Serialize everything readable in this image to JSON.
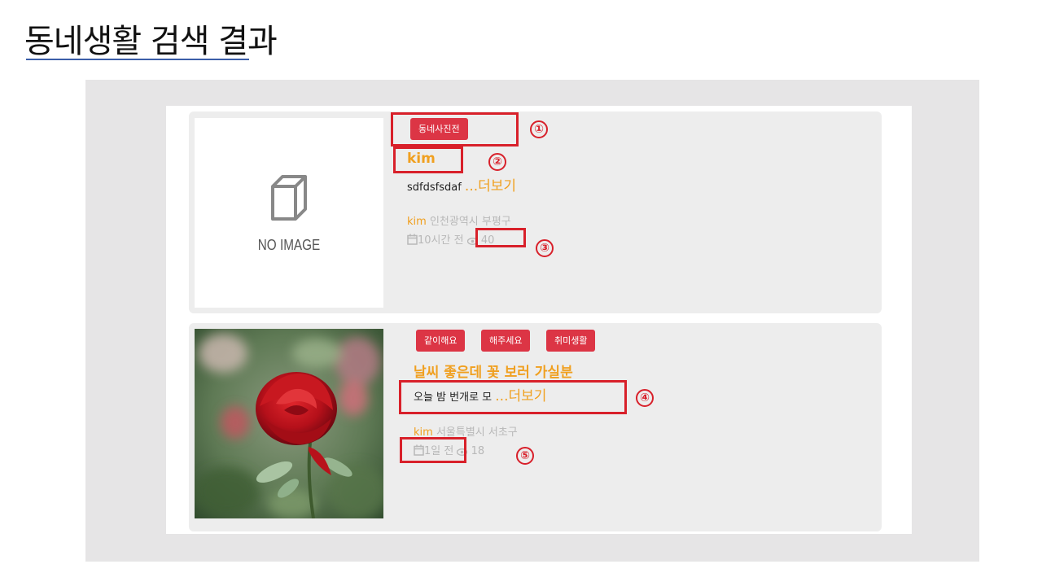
{
  "slide": {
    "title": "동네생활 검색 결과"
  },
  "posts": [
    {
      "tags": [
        "동네사진전"
      ],
      "title": "kim",
      "body": "sdfdsfsdaf",
      "more": "...더보기",
      "author": "kim",
      "location": "인천광역시 부평구",
      "time": "10시간 전",
      "views": "40",
      "thumbnail": {
        "type": "placeholder",
        "text": "NO IMAGE"
      }
    },
    {
      "tags": [
        "같이해요",
        "해주세요",
        "취미생활"
      ],
      "title": "날씨 좋은데 꽃 보러 가실분",
      "body": "오늘 밤 번개로 모",
      "more": "...더보기",
      "author": "kim",
      "location": "서울특별시 서초구",
      "time": "1일 전",
      "views": "18",
      "thumbnail": {
        "type": "photo",
        "subject": "red-rose"
      }
    }
  ],
  "annotations": [
    "①",
    "②",
    "③",
    "④",
    "⑤"
  ],
  "colors": {
    "accent": "#f0a020",
    "tag": "#dc3545",
    "highlight": "#d8202a",
    "underline": "#3b5ea8"
  }
}
